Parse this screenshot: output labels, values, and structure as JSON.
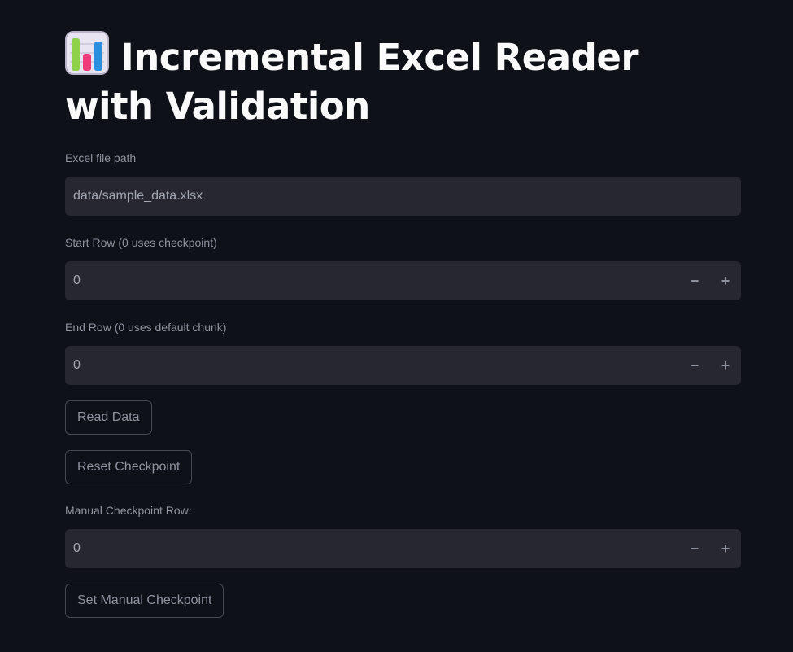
{
  "title": "Incremental Excel Reader with Validation",
  "title_icon": "bar-chart-icon",
  "fields": {
    "file_path": {
      "label": "Excel file path",
      "value": "data/sample_data.xlsx"
    },
    "start_row": {
      "label": "Start Row (0 uses checkpoint)",
      "value": "0",
      "minus": "−",
      "plus": "+"
    },
    "end_row": {
      "label": "End Row (0 uses default chunk)",
      "value": "0",
      "minus": "−",
      "plus": "+"
    },
    "manual_checkpoint": {
      "label": "Manual Checkpoint Row:",
      "value": "0",
      "minus": "−",
      "plus": "+"
    }
  },
  "buttons": {
    "read_data": "Read Data",
    "reset_checkpoint": "Reset Checkpoint",
    "set_manual_checkpoint": "Set Manual Checkpoint"
  },
  "colors": {
    "background": "#0e1117",
    "input_background": "#262730",
    "text_primary": "#fafafa",
    "text_muted": "#8f93a0"
  }
}
